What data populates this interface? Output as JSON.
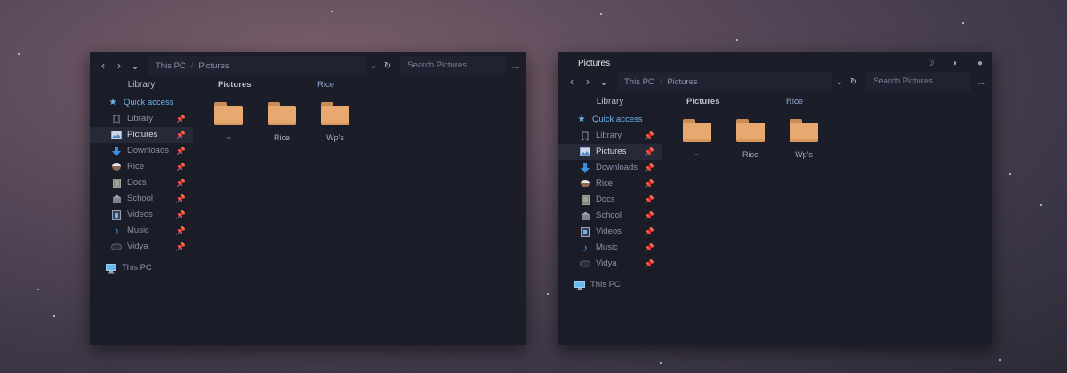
{
  "window_left": {
    "nav": {
      "back": "‹",
      "forward": "›",
      "history": "⌄",
      "address_drop": "⌄",
      "refresh": "↻",
      "more": "..."
    },
    "breadcrumb": [
      "This PC",
      "Pictures"
    ],
    "search_placeholder": "Search Pictures",
    "sidebar_header": "Library",
    "quick_access": "Quick access",
    "items": [
      {
        "label": "Library"
      },
      {
        "label": "Pictures"
      },
      {
        "label": "Downloads"
      },
      {
        "label": "Rice"
      },
      {
        "label": "Docs"
      },
      {
        "label": "School"
      },
      {
        "label": "Videos"
      },
      {
        "label": "Music"
      },
      {
        "label": "Vidya"
      }
    ],
    "this_pc": "This PC",
    "tabs": [
      "Pictures",
      "Rice"
    ],
    "folders": [
      "~",
      "Rice",
      "Wp's"
    ]
  },
  "window_right": {
    "title": "Pictures",
    "controls": [
      "☽",
      "◗",
      "●"
    ],
    "nav": {
      "back": "‹",
      "forward": "›",
      "history": "⌄",
      "address_drop": "⌄",
      "refresh": "↻",
      "more": "..."
    },
    "breadcrumb": [
      "This PC",
      "Pictures"
    ],
    "search_placeholder": "Search Pictures",
    "sidebar_header": "Library",
    "quick_access": "Quick access",
    "items": [
      {
        "label": "Library"
      },
      {
        "label": "Pictures"
      },
      {
        "label": "Downloads"
      },
      {
        "label": "Rice"
      },
      {
        "label": "Docs"
      },
      {
        "label": "School"
      },
      {
        "label": "Videos"
      },
      {
        "label": "Music"
      },
      {
        "label": "Vidya"
      }
    ],
    "this_pc": "This PC",
    "tabs": [
      "Pictures",
      "Rice"
    ],
    "folders": [
      "~",
      "Rice",
      "Wp's"
    ]
  },
  "icons": {
    "quick_access": "star-icon",
    "library": "bookmark-icon",
    "pictures": "picture-icon",
    "downloads": "download-arrow-icon",
    "rice": "bowl-icon",
    "docs": "document-icon",
    "school": "building-icon",
    "videos": "film-icon",
    "music": "music-note-icon",
    "vidya": "gamepad-icon",
    "this_pc": "monitor-icon",
    "pin": "pin-icon",
    "folder": "folder-icon"
  },
  "colors": {
    "window_bg": "#1b1d28",
    "sidebar_bg": "#1a1c27",
    "active_row": "#262937",
    "accent": "#6ab7ee",
    "folder": "#e8a970"
  }
}
